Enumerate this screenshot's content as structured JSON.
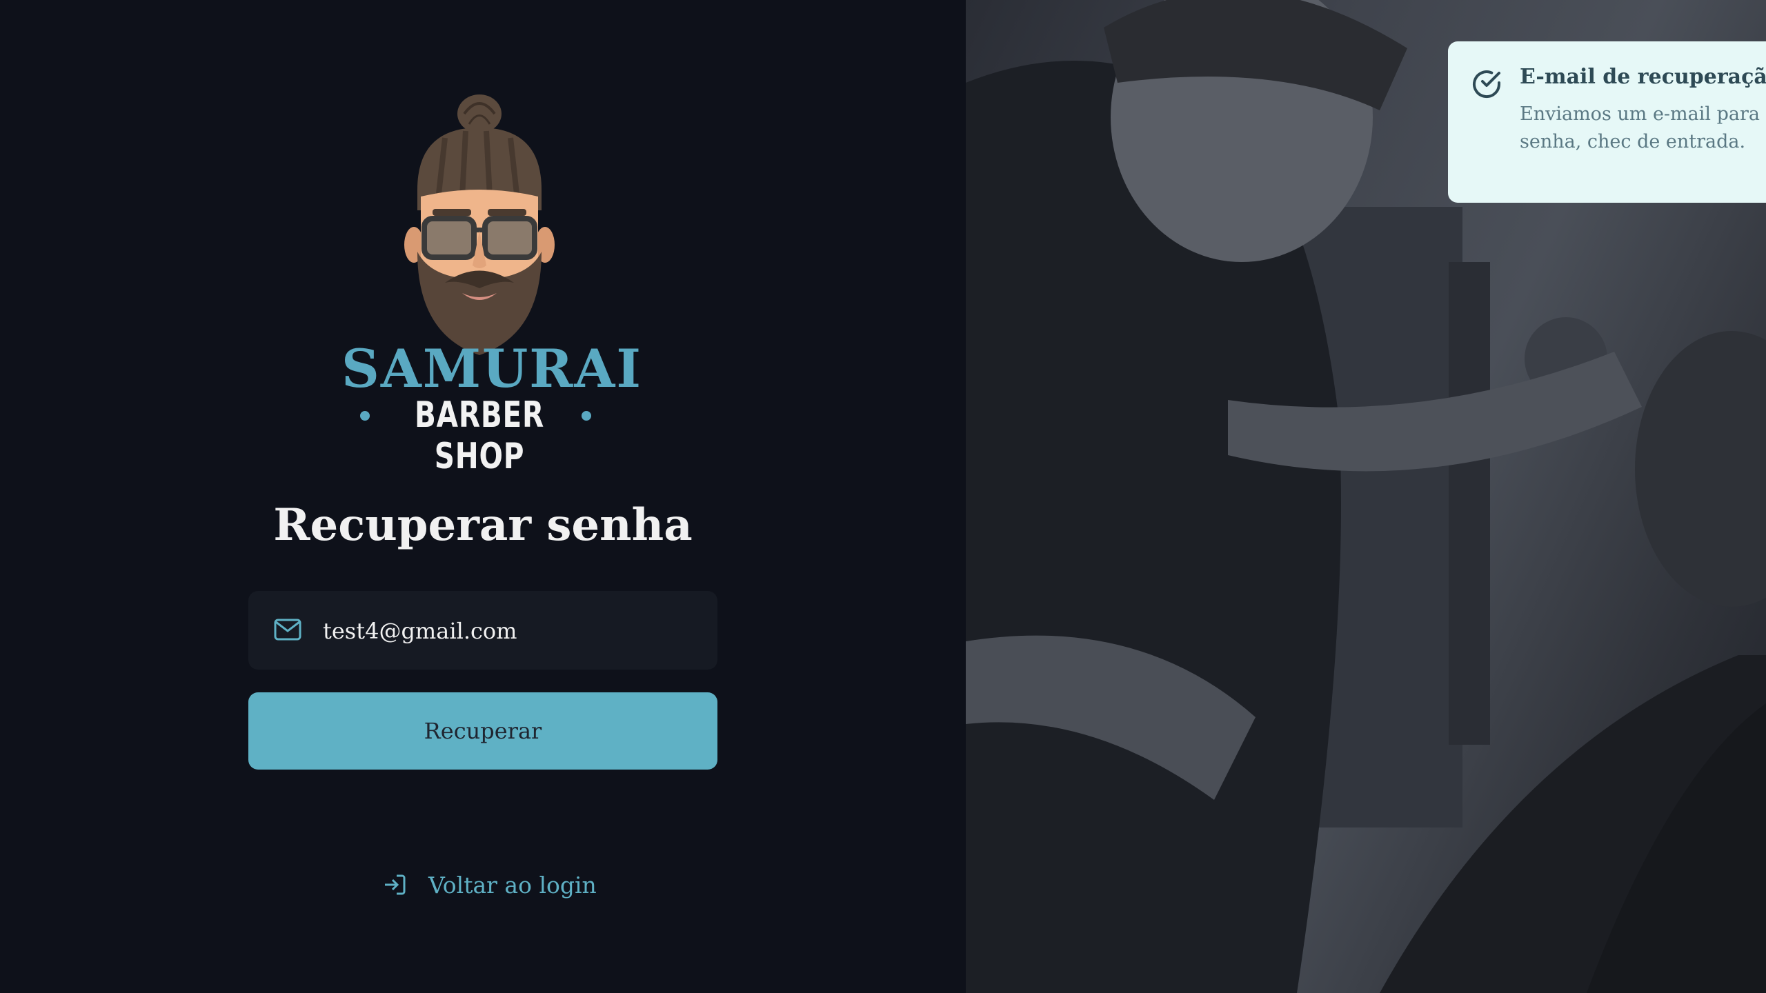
{
  "brand": {
    "title": "SAMURAI",
    "subtitle": "BARBER SHOP",
    "accent_color": "#5fb1c5"
  },
  "form": {
    "heading": "Recuperar senha",
    "email_value": "test4@gmail.com",
    "email_icon": "mail-icon",
    "submit_label": "Recuperar",
    "back_link_label": "Voltar ao login",
    "back_link_icon": "login-icon"
  },
  "toast": {
    "icon": "check-circle-icon",
    "title": "E-mail de recuperação e",
    "message": "Enviamos um e-mail para c recuperação de senha, chec de entrada."
  },
  "background_photo": {
    "description_icon": "barber-photo"
  }
}
